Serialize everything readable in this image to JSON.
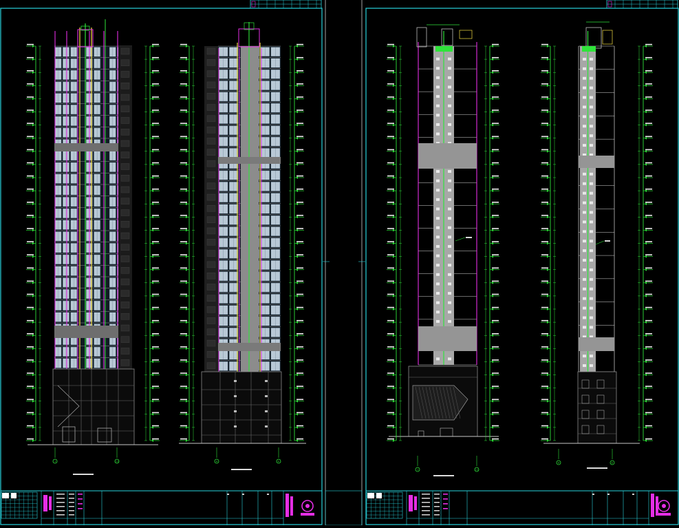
{
  "colors": {
    "background": "#000000",
    "frame": "#27d3dd",
    "dim": "#2fe33a",
    "magenta": "#e52ee5",
    "yellow": "#d8c23a",
    "gray": "#7d7d7d",
    "window": "#b9c9d6",
    "grid": "#d9d9d9"
  },
  "sheets": [
    {
      "elevations": [
        {
          "callout_left": "1",
          "callout_right": "11"
        },
        {
          "callout_left": "A",
          "callout_right": "E"
        }
      ]
    },
    {
      "elevations": [
        {
          "callout_left": "1",
          "callout_right": "11"
        },
        {
          "callout_left": "A",
          "callout_right": "E"
        }
      ]
    }
  ],
  "icons": [
    "logo-seal-icon",
    "level-marker-icon",
    "axis-callout-icon"
  ]
}
